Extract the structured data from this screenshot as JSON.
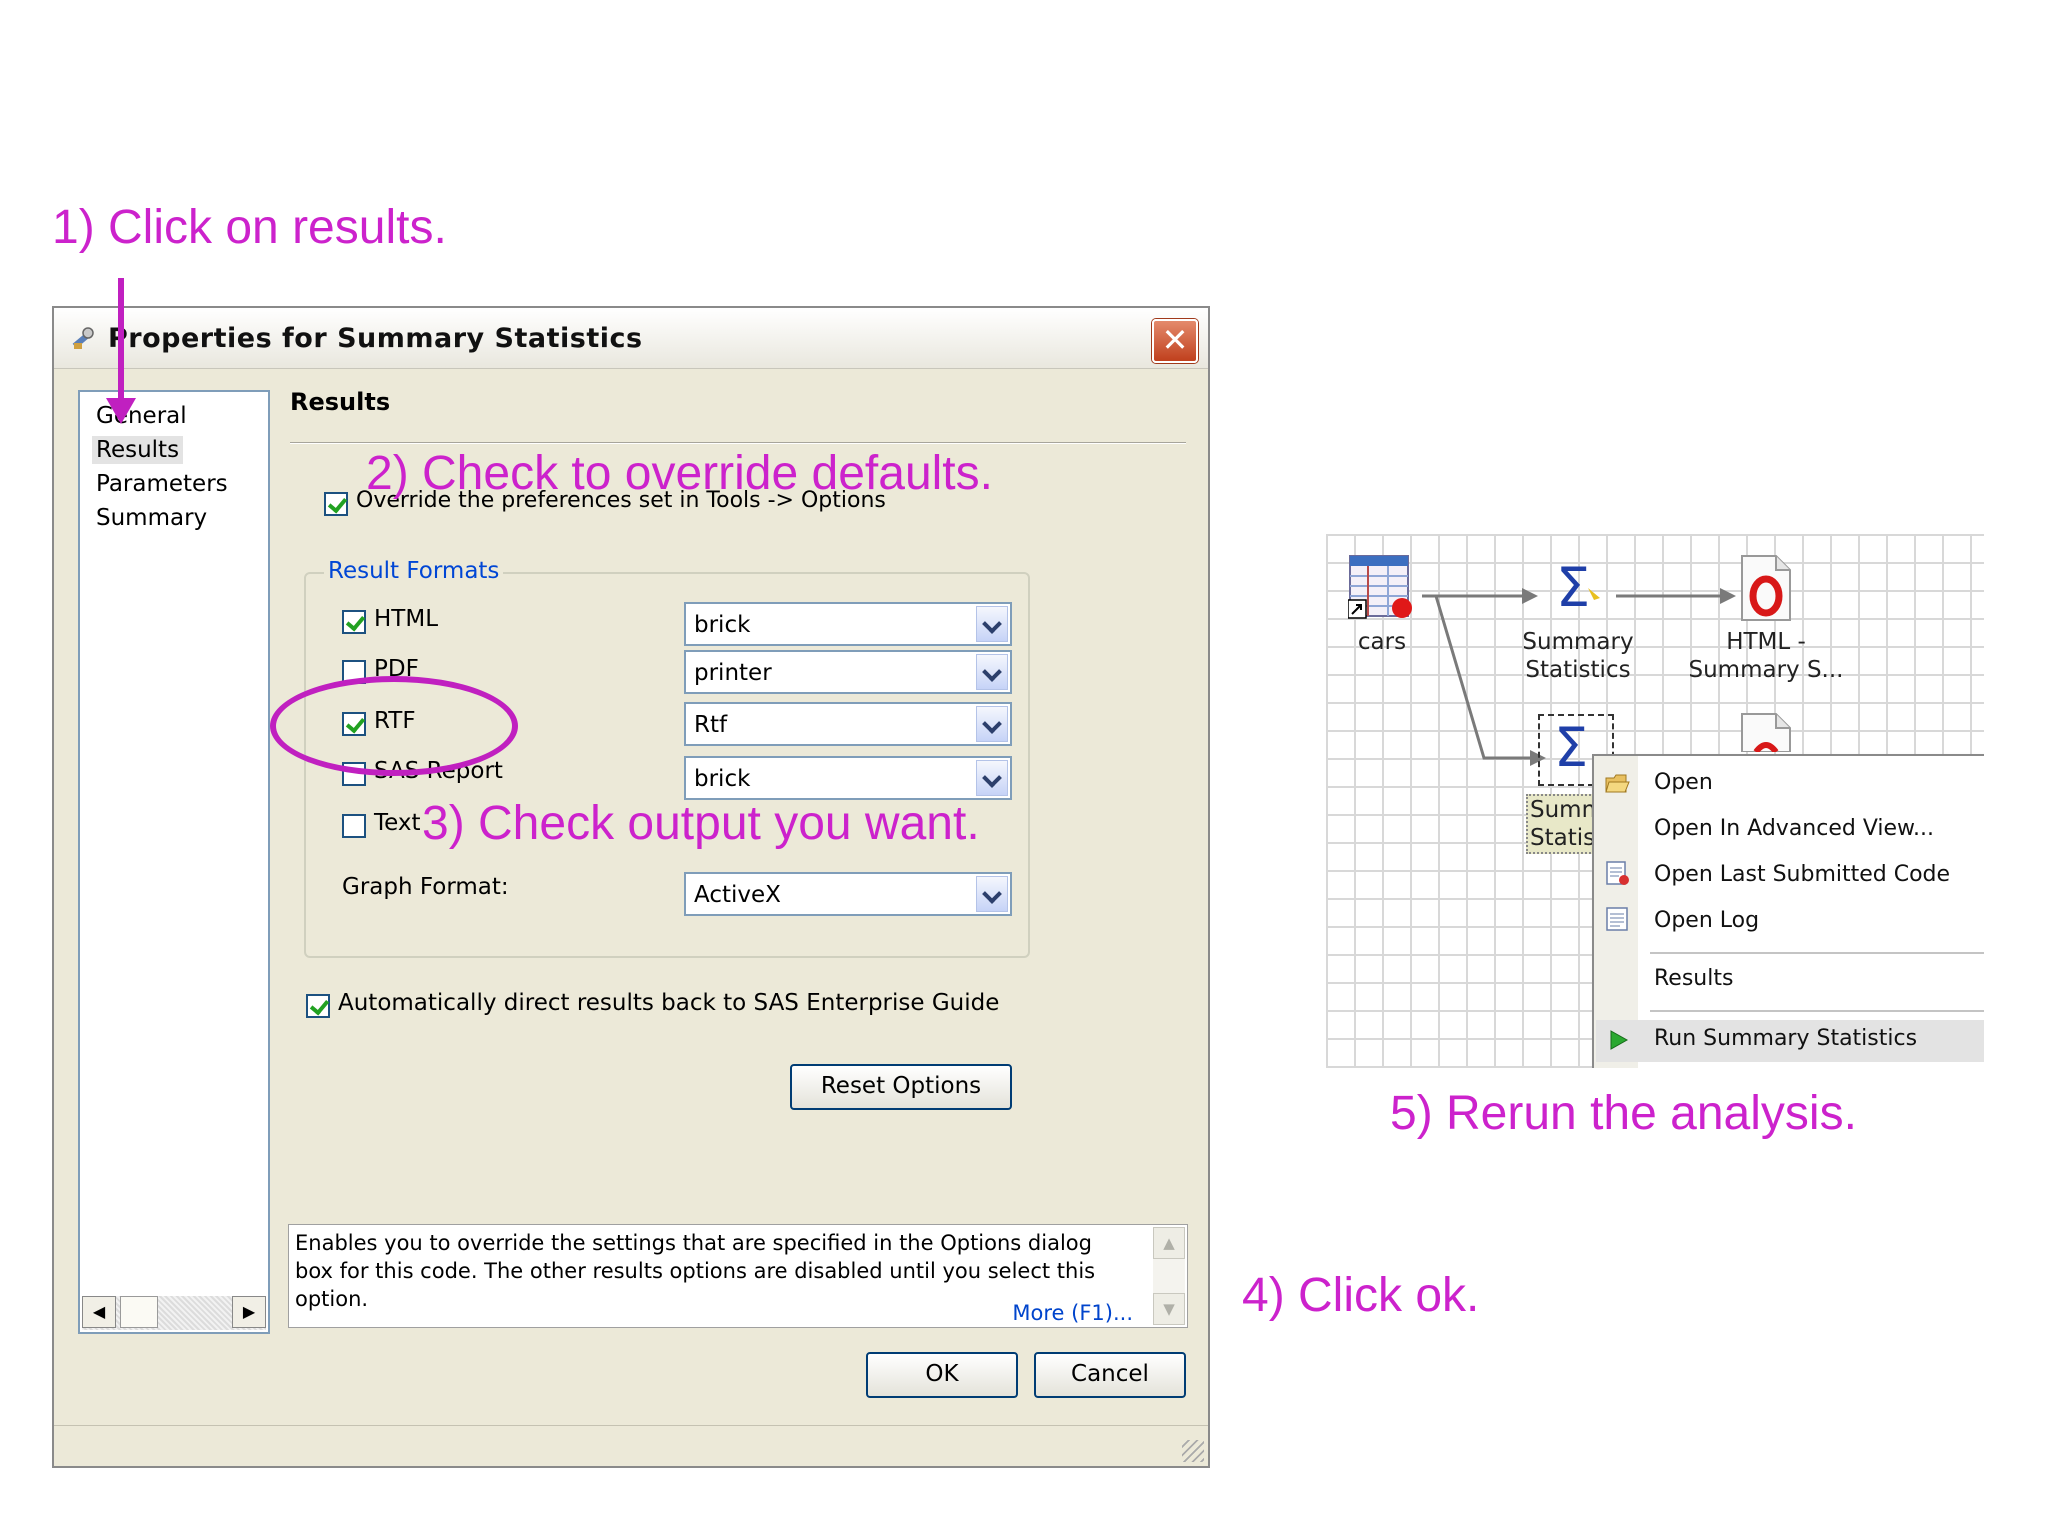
{
  "annotations": {
    "step1": "1) Click on results.",
    "step2": "2) Check to override defaults.",
    "step3": "3) Check output you want.",
    "step4": "4) Click ok.",
    "step5": "5) Rerun the analysis."
  },
  "dialog": {
    "title": "Properties for Summary Statistics",
    "nav_items": [
      "General",
      "Results",
      "Parameters",
      "Summary"
    ],
    "selected_nav": "Results",
    "section_title": "Results",
    "override_label": "Override the preferences set in Tools -> Options",
    "override_checked": true,
    "group_title": "Result Formats",
    "formats": [
      {
        "label": "HTML",
        "checked": true,
        "style": "brick"
      },
      {
        "label": "PDF",
        "checked": false,
        "style": "printer"
      },
      {
        "label": "RTF",
        "checked": true,
        "style": "Rtf"
      },
      {
        "label": "SAS Report",
        "checked": false,
        "style": "brick"
      },
      {
        "label": "Text",
        "checked": false
      }
    ],
    "graph_format_label": "Graph Format:",
    "graph_format_value": "ActiveX",
    "auto_direct_label": "Automatically direct results back to SAS Enterprise Guide",
    "auto_direct_checked": true,
    "reset_label": "Reset Options",
    "description": "Enables you to override the settings that are specified in the Options dialog box for this code. The other results options are disabled until you select this option.",
    "more_link": "More (F1)...",
    "ok_label": "OK",
    "cancel_label": "Cancel"
  },
  "flow": {
    "nodes": {
      "cars": "cars",
      "summary1": [
        "Summary",
        "Statistics"
      ],
      "html1": [
        "HTML -",
        "Summary S..."
      ],
      "summary2": [
        "Summ",
        "Statis"
      ]
    },
    "context_menu": {
      "items": [
        "Open",
        "Open In Advanced View...",
        "Open Last Submitted Code",
        "Open Log",
        "Results",
        "Run Summary Statistics"
      ],
      "highlighted": "Run Summary Statistics"
    }
  },
  "colors": {
    "annotation": "#cc22cc",
    "link": "#0044cc",
    "group_title": "#0046d5",
    "check": "#21a121"
  }
}
